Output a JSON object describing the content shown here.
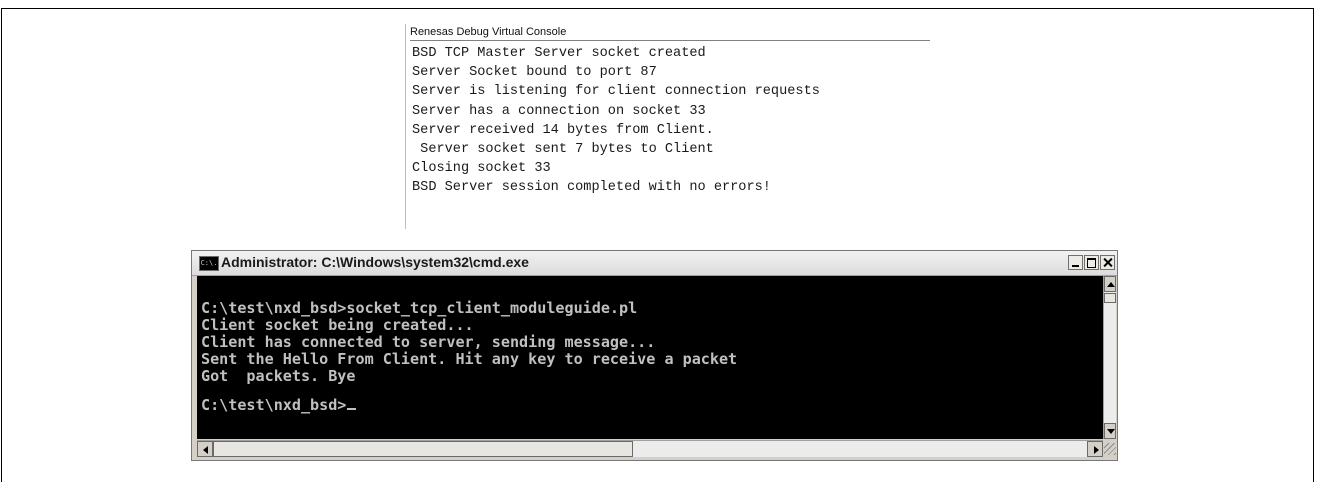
{
  "debug_console": {
    "title": "Renesas Debug Virtual Console",
    "lines": [
      "BSD TCP Master Server socket created",
      "Server Socket bound to port 87",
      "Server is listening for client connection requests",
      "Server has a connection on socket 33",
      "Server received 14 bytes from Client.",
      " Server socket sent 7 bytes to Client",
      "Closing socket 33",
      "BSD Server session completed with no errors!"
    ]
  },
  "cmd_window": {
    "icon": "cmd-icon",
    "icon_text": "C:\\.",
    "title": "Administrator: C:\\Windows\\system32\\cmd.exe",
    "lines": [
      "C:\\test\\nxd_bsd>socket_tcp_client_moduleguide.pl",
      "Client socket being created...",
      "Client has connected to server, sending message...",
      "Sent the Hello From Client. Hit any key to receive a packet",
      "Got  packets. Bye",
      "",
      "C:\\test\\nxd_bsd>"
    ],
    "colors": {
      "console_bg": "#000000",
      "console_text": "#c0c0c0"
    }
  }
}
